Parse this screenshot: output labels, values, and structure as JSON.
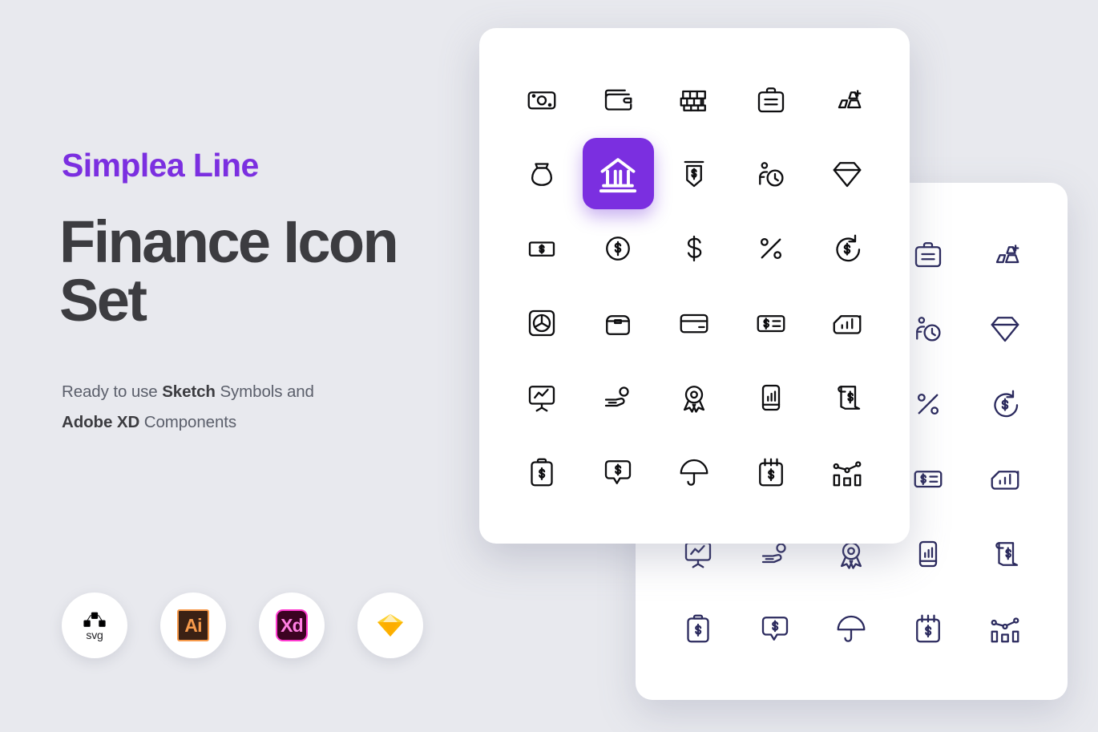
{
  "hero": {
    "eyebrow": "Simplea Line",
    "headline": "Finance Icon Set",
    "subtitle_line1_prefix": "Ready to use ",
    "subtitle_line1_bold": "Sketch",
    "subtitle_line1_suffix": " Symbols and",
    "subtitle_line2_bold": "Adobe XD",
    "subtitle_line2_suffix": " Components"
  },
  "colors": {
    "background": "#e8e9ee",
    "accent_purple": "#7b2fe0",
    "headline_gray": "#3c3c40",
    "subtitle_gray": "#5b5f6b",
    "card_white": "#ffffff",
    "back_icon_navy": "#2b2a5e",
    "back_icon_purple": "#7b43ee",
    "front_icon_black": "#0d0d0f"
  },
  "badges": [
    {
      "id": "svg",
      "label": "svg",
      "icon": "bezier-path-icon"
    },
    {
      "id": "illustrator",
      "label": "Ai",
      "icon": "adobe-illustrator-icon"
    },
    {
      "id": "xd",
      "label": "Xd",
      "icon": "adobe-xd-icon"
    },
    {
      "id": "sketch",
      "label": "",
      "icon": "sketch-diamond-icon"
    }
  ],
  "front_card": {
    "highlighted_index": 6,
    "icons": [
      {
        "name": "banknote-icon",
        "row": 1,
        "col": 1
      },
      {
        "name": "wallet-icon",
        "row": 1,
        "col": 2
      },
      {
        "name": "money-stack-icon",
        "row": 1,
        "col": 3
      },
      {
        "name": "briefcase-icon",
        "row": 1,
        "col": 4
      },
      {
        "name": "gold-bars-icon",
        "row": 1,
        "col": 5
      },
      {
        "name": "money-bag-icon",
        "row": 2,
        "col": 1
      },
      {
        "name": "bank-icon",
        "row": 2,
        "col": 2
      },
      {
        "name": "atm-receipt-icon",
        "row": 2,
        "col": 3
      },
      {
        "name": "person-clock-icon",
        "row": 2,
        "col": 4
      },
      {
        "name": "diamond-icon",
        "row": 2,
        "col": 5
      },
      {
        "name": "dollar-bill-icon",
        "row": 3,
        "col": 1
      },
      {
        "name": "coin-dollar-icon",
        "row": 3,
        "col": 2
      },
      {
        "name": "dollar-sign-icon",
        "row": 3,
        "col": 3
      },
      {
        "name": "percent-icon",
        "row": 3,
        "col": 4
      },
      {
        "name": "refund-dollar-icon",
        "row": 3,
        "col": 5
      },
      {
        "name": "pie-chart-icon",
        "row": 4,
        "col": 1
      },
      {
        "name": "archive-box-icon",
        "row": 4,
        "col": 2
      },
      {
        "name": "credit-card-icon",
        "row": 4,
        "col": 3
      },
      {
        "name": "cheque-icon",
        "row": 4,
        "col": 4
      },
      {
        "name": "bar-chart-card-icon",
        "row": 4,
        "col": 5
      },
      {
        "name": "presentation-chart-icon",
        "row": 5,
        "col": 1
      },
      {
        "name": "hand-coin-icon",
        "row": 5,
        "col": 2
      },
      {
        "name": "award-medal-icon",
        "row": 5,
        "col": 3
      },
      {
        "name": "mobile-report-icon",
        "row": 5,
        "col": 4
      },
      {
        "name": "receipt-scroll-icon",
        "row": 5,
        "col": 5
      },
      {
        "name": "clipboard-dollar-icon",
        "row": 6,
        "col": 1
      },
      {
        "name": "chat-dollar-icon",
        "row": 6,
        "col": 2
      },
      {
        "name": "umbrella-icon",
        "row": 6,
        "col": 3
      },
      {
        "name": "notepad-dollar-icon",
        "row": 6,
        "col": 4
      },
      {
        "name": "combo-chart-icon",
        "row": 6,
        "col": 5
      }
    ]
  },
  "back_card": {
    "icons": [
      {
        "name": "banknote-icon",
        "row": 1,
        "col": 1
      },
      {
        "name": "wallet-icon",
        "row": 1,
        "col": 2
      },
      {
        "name": "money-stack-icon",
        "row": 1,
        "col": 3
      },
      {
        "name": "briefcase-icon",
        "row": 1,
        "col": 4
      },
      {
        "name": "gold-bars-icon",
        "row": 1,
        "col": 5
      },
      {
        "name": "money-bag-icon",
        "row": 2,
        "col": 1
      },
      {
        "name": "bank-icon",
        "row": 2,
        "col": 2
      },
      {
        "name": "atm-receipt-icon",
        "row": 2,
        "col": 3
      },
      {
        "name": "person-clock-icon",
        "row": 2,
        "col": 4
      },
      {
        "name": "diamond-icon",
        "row": 2,
        "col": 5
      },
      {
        "name": "dollar-bill-icon",
        "row": 3,
        "col": 1
      },
      {
        "name": "coin-dollar-icon",
        "row": 3,
        "col": 2
      },
      {
        "name": "dollar-sign-icon",
        "row": 3,
        "col": 3
      },
      {
        "name": "percent-icon",
        "row": 3,
        "col": 4
      },
      {
        "name": "refund-dollar-icon",
        "row": 3,
        "col": 5
      },
      {
        "name": "pie-chart-icon",
        "row": 4,
        "col": 1
      },
      {
        "name": "archive-box-icon",
        "row": 4,
        "col": 2
      },
      {
        "name": "credit-card-icon",
        "row": 4,
        "col": 3
      },
      {
        "name": "cheque-icon",
        "row": 4,
        "col": 4
      },
      {
        "name": "bar-chart-card-icon",
        "row": 4,
        "col": 5
      },
      {
        "name": "presentation-chart-icon",
        "row": 5,
        "col": 1
      },
      {
        "name": "hand-coin-icon",
        "row": 5,
        "col": 2
      },
      {
        "name": "award-medal-icon",
        "row": 5,
        "col": 3
      },
      {
        "name": "mobile-report-icon",
        "row": 5,
        "col": 4
      },
      {
        "name": "receipt-scroll-icon",
        "row": 5,
        "col": 5
      },
      {
        "name": "clipboard-dollar-icon",
        "row": 6,
        "col": 1
      },
      {
        "name": "chat-dollar-icon",
        "row": 6,
        "col": 2
      },
      {
        "name": "umbrella-icon",
        "row": 6,
        "col": 3
      },
      {
        "name": "notepad-dollar-icon",
        "row": 6,
        "col": 4
      },
      {
        "name": "combo-chart-icon",
        "row": 6,
        "col": 5
      }
    ]
  }
}
